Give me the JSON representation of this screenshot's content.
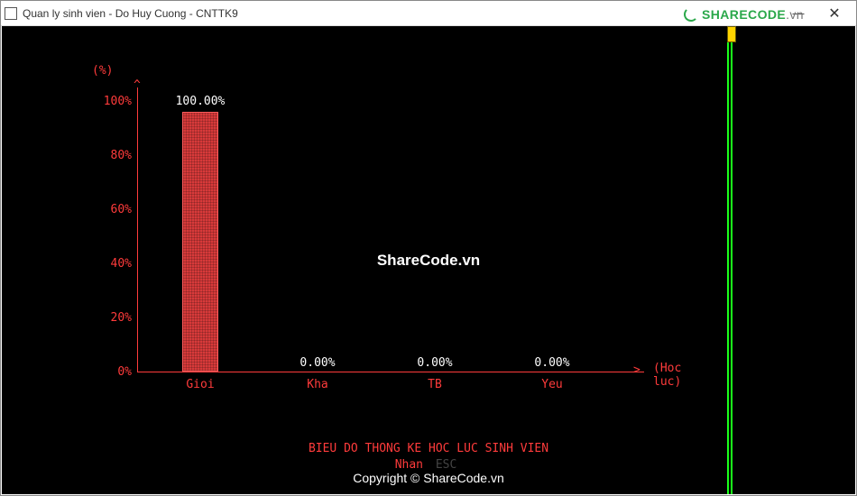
{
  "window": {
    "title": "Quan ly sinh vien - Do Huy Cuong - CNTTK9"
  },
  "logo": {
    "text_main": "SHARECODE",
    "text_suffix": ".vn"
  },
  "chart_data": {
    "type": "bar",
    "categories": [
      "Gioi",
      "Kha",
      "TB",
      "Yeu"
    ],
    "values": [
      100.0,
      0.0,
      0.0,
      0.0
    ],
    "value_labels": [
      "100.00%",
      "0.00%",
      "0.00%",
      "0.00%"
    ],
    "title": "BIEU DO THONG KE HOC LUC SINH VIEN",
    "hint_prefix": "Nhan",
    "hint_key": "ESC",
    "hint_suffix": "",
    "xlabel": "(Hoc luc)",
    "ylabel": "(%)",
    "y_arrow": "^",
    "x_arrow": ">",
    "ylim": [
      0,
      100
    ],
    "y_ticks": [
      "0%",
      "20%",
      "40%",
      "60%",
      "80%",
      "100%"
    ]
  },
  "watermarks": {
    "center": "ShareCode.vn",
    "bottom": "Copyright © ShareCode.vn"
  }
}
